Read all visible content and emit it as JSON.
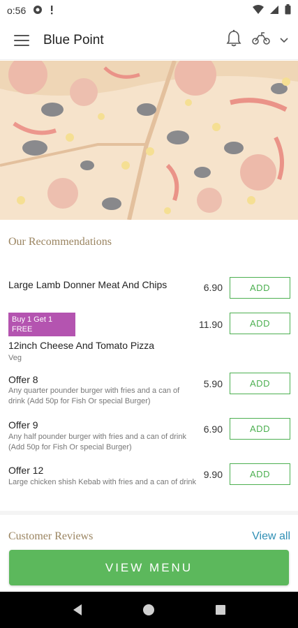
{
  "status_bar": {
    "time": "o:56"
  },
  "app_bar": {
    "title": "Blue Point"
  },
  "recommendations": {
    "title": "Our Recommendations",
    "items": [
      {
        "name": "Large Lamb Donner Meat And Chips",
        "price": "6.90",
        "add_label": "ADD"
      },
      {
        "badge": "Buy 1 Get 1 FREE",
        "name": "12inch Cheese And Tomato Pizza",
        "desc": "Veg",
        "price": "11.90",
        "add_label": "ADD"
      },
      {
        "name": "Offer 8",
        "desc": "Any quarter pounder burger with fries and a can of drink (Add 50p for Fish Or special Burger)",
        "price": "5.90",
        "add_label": "ADD"
      },
      {
        "name": "Offer 9",
        "desc": "Any half pounder burger with fries and a can of drink (Add 50p for Fish Or special Burger)",
        "price": "6.90",
        "add_label": "ADD"
      },
      {
        "name": "Offer 12",
        "desc": "Large chicken shish Kebab with fries and a can of drink",
        "price": "9.90",
        "add_label": "ADD"
      }
    ]
  },
  "reviews": {
    "title": "Customer Reviews",
    "view_all": "View all"
  },
  "cta": {
    "label": "VIEW MENU"
  },
  "colors": {
    "accent_green": "#5cb85c",
    "badge_purple": "#b454b0",
    "section_gold": "#9a8460",
    "link_blue": "#2f8fb5"
  },
  "icons": [
    "hamburger-menu-icon",
    "bell-icon",
    "scooter-icon",
    "chevron-down-icon",
    "wifi-icon",
    "signal-icon",
    "battery-icon",
    "back-icon",
    "home-icon",
    "recents-icon"
  ]
}
